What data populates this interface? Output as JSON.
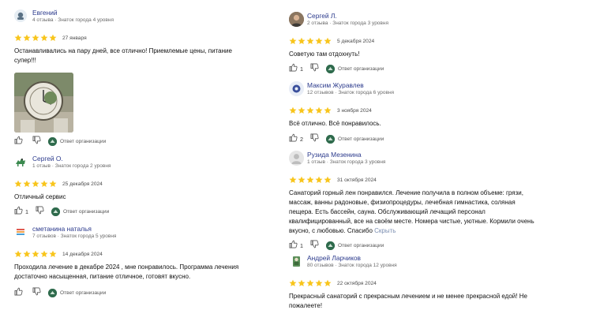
{
  "colors": {
    "star": "#f8c51c",
    "name": "#2b3a8c",
    "meta": "#6b6b6b",
    "org_logo": "#2f6b4d"
  },
  "icons": {
    "like": "thumb-up-icon",
    "dislike": "thumb-down-icon",
    "org": "organization-logo-icon"
  },
  "reviews_left": [
    {
      "name": "Евгений",
      "meta": "4 отзыва · Знаток города 4 уровня",
      "rating": 5,
      "date": "27 января",
      "text": "Останавливались на пару дней, все отлично! Приемлемые цены, питание супер!!!",
      "has_photo": true,
      "likes": "",
      "reply_label": "Ответ организации"
    },
    {
      "name": "Сергей О.",
      "meta": "1 отзыв · Знаток города 2 уровня",
      "rating": 5,
      "date": "25 декабря 2024",
      "text": "Отличный сервис",
      "likes": "1",
      "reply_label": "Ответ организации"
    },
    {
      "name": "сметанина наталья",
      "meta": "7 отзывов · Знаток города 5 уровня",
      "rating": 5,
      "date": "14 декабря 2024",
      "text": "Проходила лечение в декабре 2024 , мне понравилось. Программа лечения достаточно насыщенная, питание отличное, готовят вкусно.",
      "likes": "",
      "reply_label": "Ответ организации"
    }
  ],
  "reviews_right": [
    {
      "name": "Сергей Л.",
      "meta": "2 отзыва · Знаток города 3 уровня",
      "rating": 5,
      "date": "5 декабря 2024",
      "text": "Советую там отдохнуть!",
      "likes": "1",
      "reply_label": "Ответ организации"
    },
    {
      "name": "Максим Журавлев",
      "meta": "12 отзывов · Знаток города 6 уровня",
      "rating": 5,
      "date": "3 ноября 2024",
      "text": "Всё отлично. Всё понравилось.",
      "likes": "2",
      "reply_label": "Ответ организации"
    },
    {
      "name": "Рузида Мезенина",
      "meta": "1 отзыв · Знаток города 3 уровня",
      "rating": 5,
      "date": "31 октября 2024",
      "text": "Санаторий горный лен понравился. Лечение получила в полном объеме: грязи, массаж, ванны радоновые, физиопроцедуры, лечебная гимнастика, соляная пещера. Есть бассейн, сауна. Обслуживающий лечащий персонал квалифицированный, все на своём месте. Номера чистые, уютные. Кормили очень вкусно, с любовью. Спасибо",
      "more_label": "Скрыть",
      "likes": "1",
      "reply_label": "Ответ организации"
    },
    {
      "name": "Андрей Ларчиков",
      "meta": "80 отзывов · Знаток города 12 уровня",
      "rating": 5,
      "date": "22 октября 2024",
      "text": "Прекрасный санаторий с прекрасным лечением и не менее прекрасной едой! Не пожалеете!"
    }
  ]
}
